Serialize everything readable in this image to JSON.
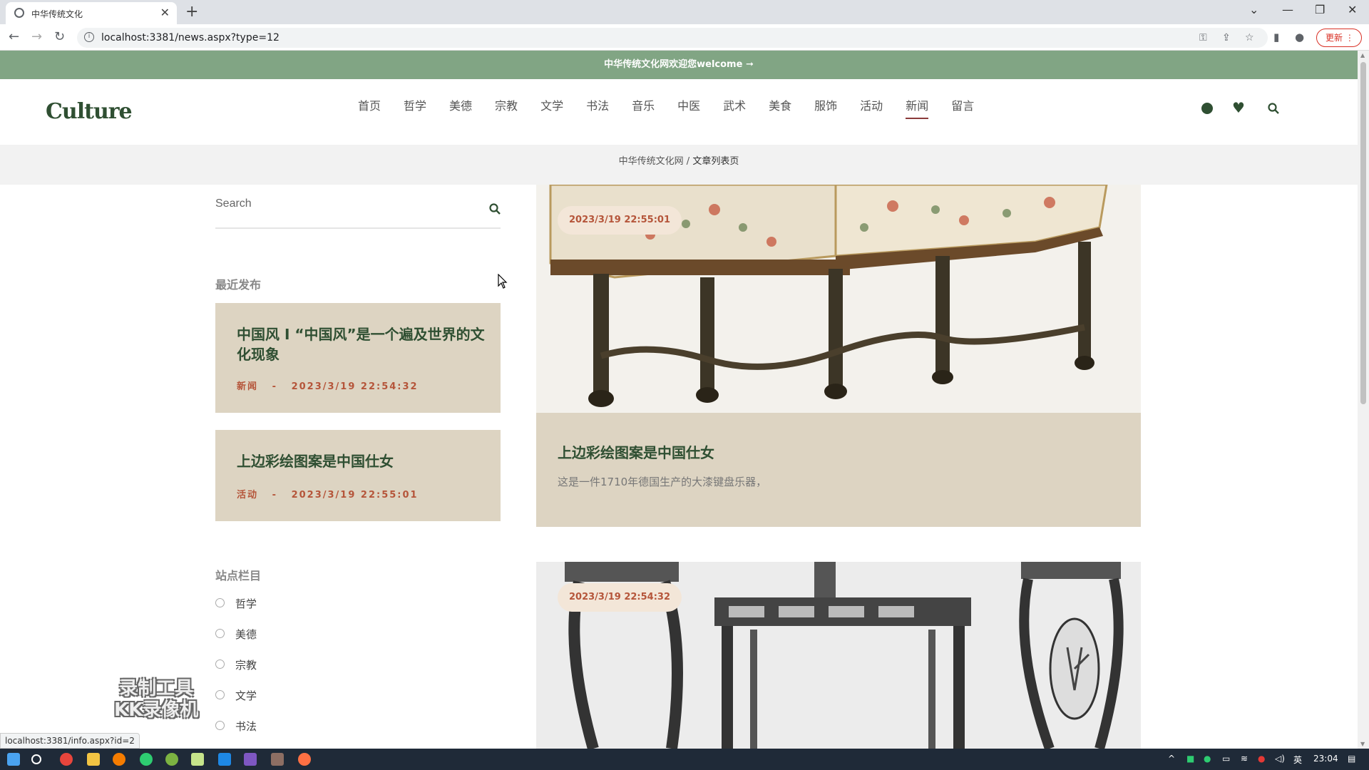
{
  "browser": {
    "tab_title": "中华传统文化",
    "url": "localhost:3381/news.aspx?type=12",
    "update_label": "更新",
    "status_url": "localhost:3381/info.aspx?id=2"
  },
  "site": {
    "welcome": "中华传统文化网欢迎您welcome ➞",
    "logo": "Culture",
    "nav": [
      "首页",
      "哲学",
      "美德",
      "宗教",
      "文学",
      "书法",
      "音乐",
      "中医",
      "武术",
      "美食",
      "服饰",
      "活动",
      "新闻",
      "留言"
    ],
    "active_nav": "新闻",
    "breadcrumb": {
      "home": "中华传统文化网",
      "separator": " / ",
      "current": "文章列表页"
    }
  },
  "sidebar": {
    "search_placeholder": "Search",
    "recent_title": "最近发布",
    "recent": [
      {
        "title": "中国风 I “中国风”是一个遍及世界的文化现象",
        "category": "新闻",
        "sep": "-",
        "date": "2023/3/19 22:54:32"
      },
      {
        "title": "上边彩绘图案是中国仕女",
        "category": "活动",
        "sep": "-",
        "date": "2023/3/19 22:55:01"
      }
    ],
    "categories_title": "站点栏目",
    "categories": [
      "哲学",
      "美德",
      "宗教",
      "文学",
      "书法"
    ]
  },
  "posts": [
    {
      "date": "2023/3/19 22:55:01",
      "title": "上边彩绘图案是中国仕女",
      "excerpt": "这是一件1710年德国生产的大漆键盘乐器，"
    },
    {
      "date": "2023/3/19 22:54:32"
    }
  ],
  "watermark": [
    "录制工具",
    "KK录像机"
  ],
  "taskbar": {
    "lang": "英",
    "time": "23:04"
  },
  "colors": {
    "accent_green": "#81a584",
    "dark_green": "#2f4f32",
    "card_beige": "#ddd4c2",
    "date_red": "#b5553a"
  }
}
